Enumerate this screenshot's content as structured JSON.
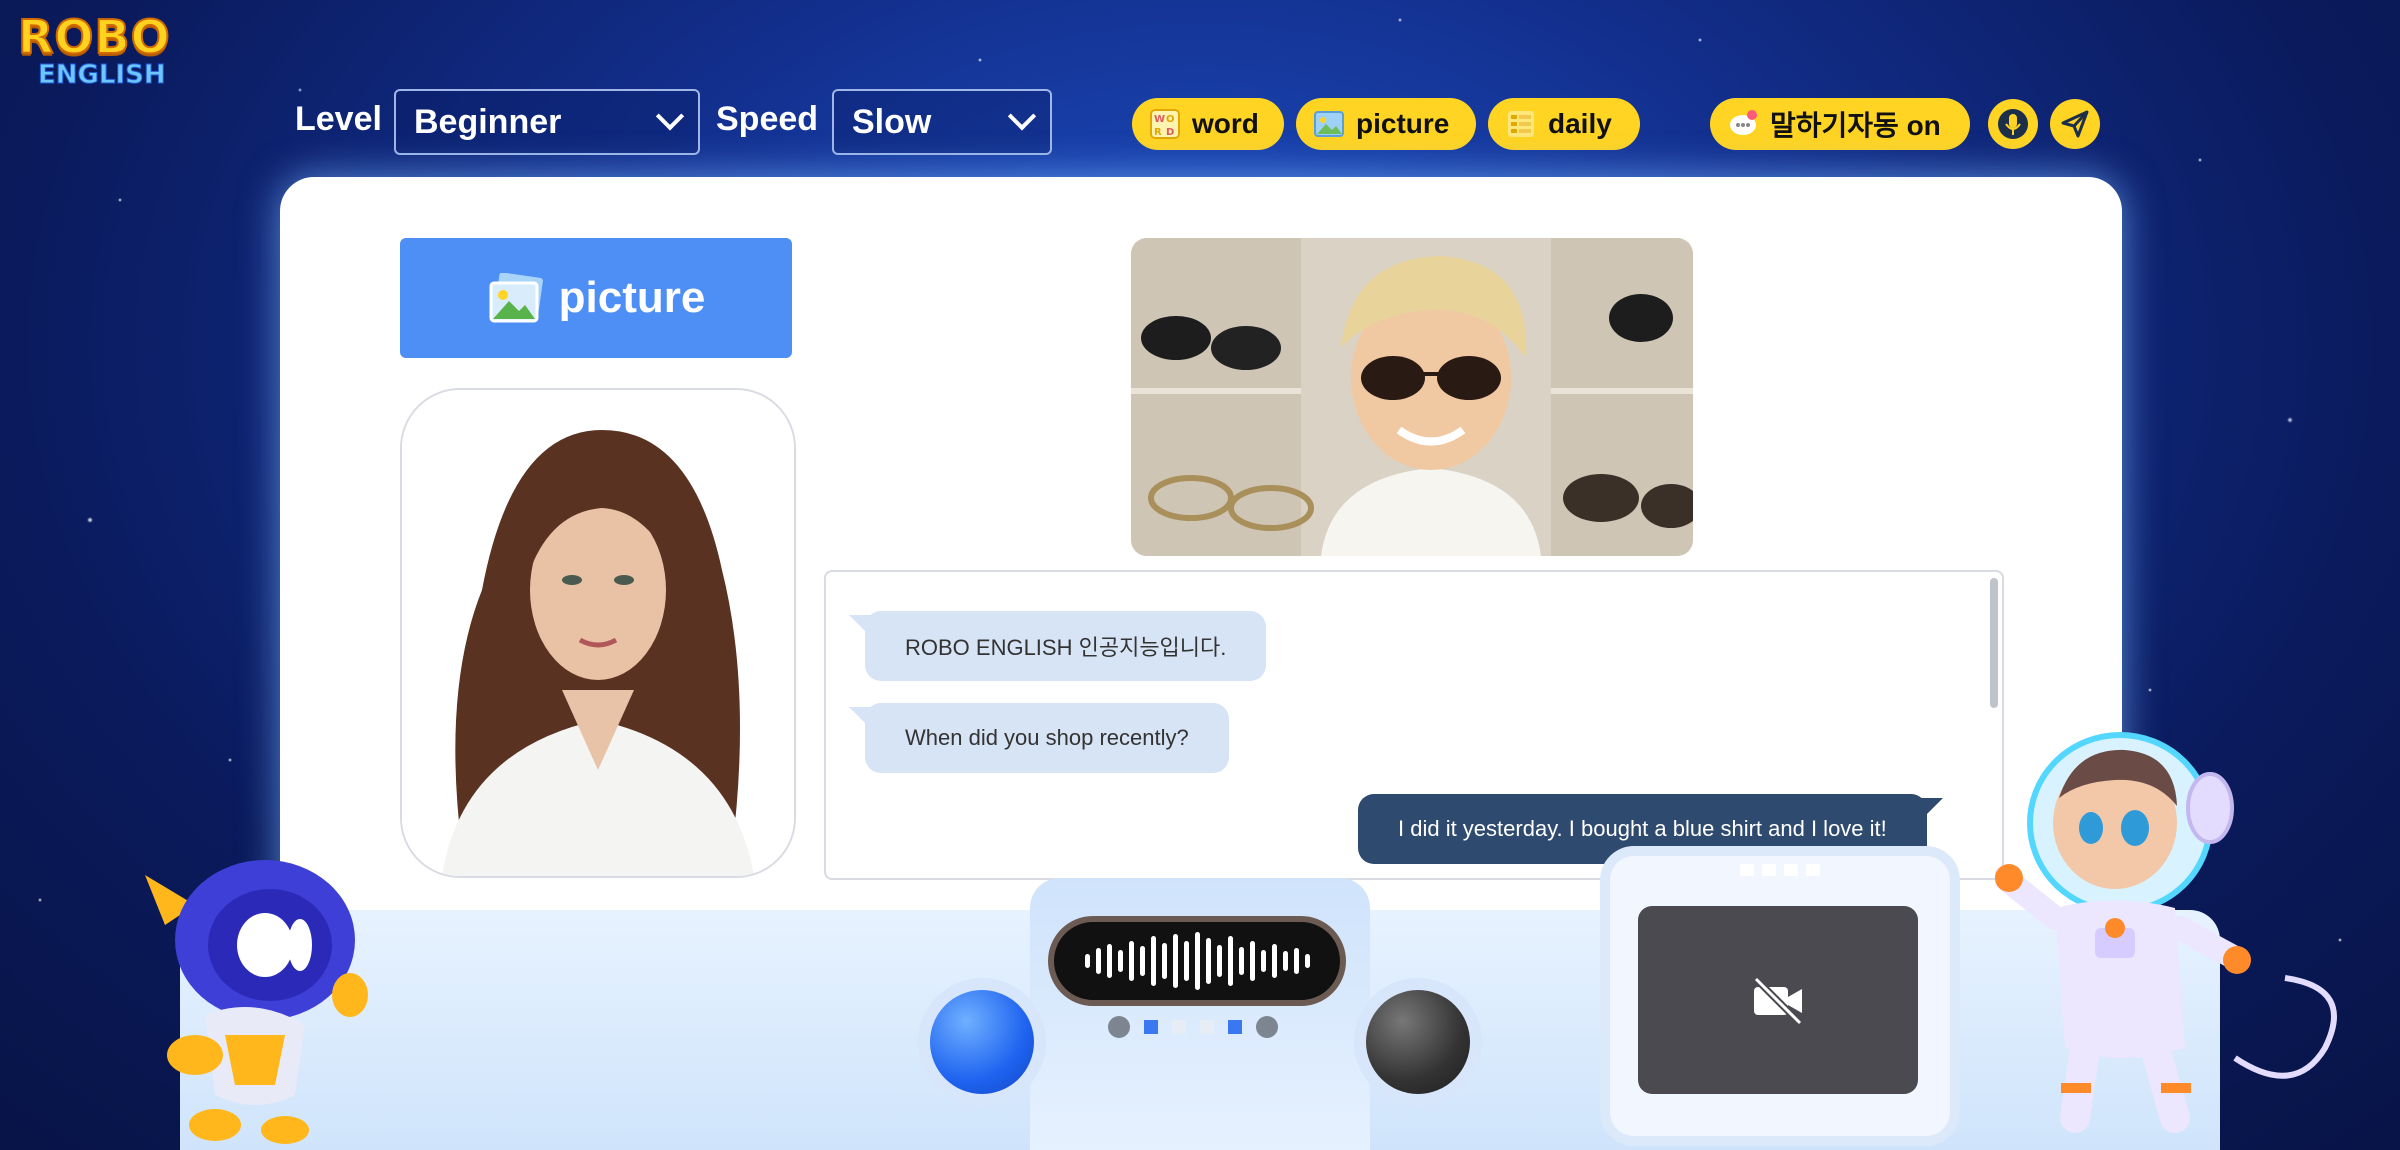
{
  "app": {
    "logo_line1": "ROBO",
    "logo_line2": "ENGLISH"
  },
  "controls": {
    "level_label": "Level",
    "level_value": "Beginner",
    "speed_label": "Speed",
    "speed_value": "Slow"
  },
  "modes": [
    {
      "label": "word",
      "icon": "word-card-icon"
    },
    {
      "label": "picture",
      "icon": "picture-icon"
    },
    {
      "label": "daily",
      "icon": "daily-list-icon"
    }
  ],
  "auto_speak": {
    "label": "말하기자동 on",
    "icon": "chat-bubble-icon"
  },
  "action_icons": [
    "microphone-icon",
    "send-icon"
  ],
  "main": {
    "picture_button_label": "picture"
  },
  "chat": {
    "messages": [
      {
        "side": "left",
        "text": "ROBO ENGLISH 인공지능입니다."
      },
      {
        "side": "left",
        "text": "When did you shop recently?"
      },
      {
        "side": "right",
        "text": "I did it yesterday. I bought a blue shirt and I love it!"
      }
    ]
  },
  "camera": {
    "status_icon": "camera-off-icon"
  },
  "colors": {
    "accent_yellow": "#ffd422",
    "primary_blue": "#4d8ff5",
    "bubble_user": "#2f4a6f",
    "bubble_bot": "#d7e4f5"
  }
}
